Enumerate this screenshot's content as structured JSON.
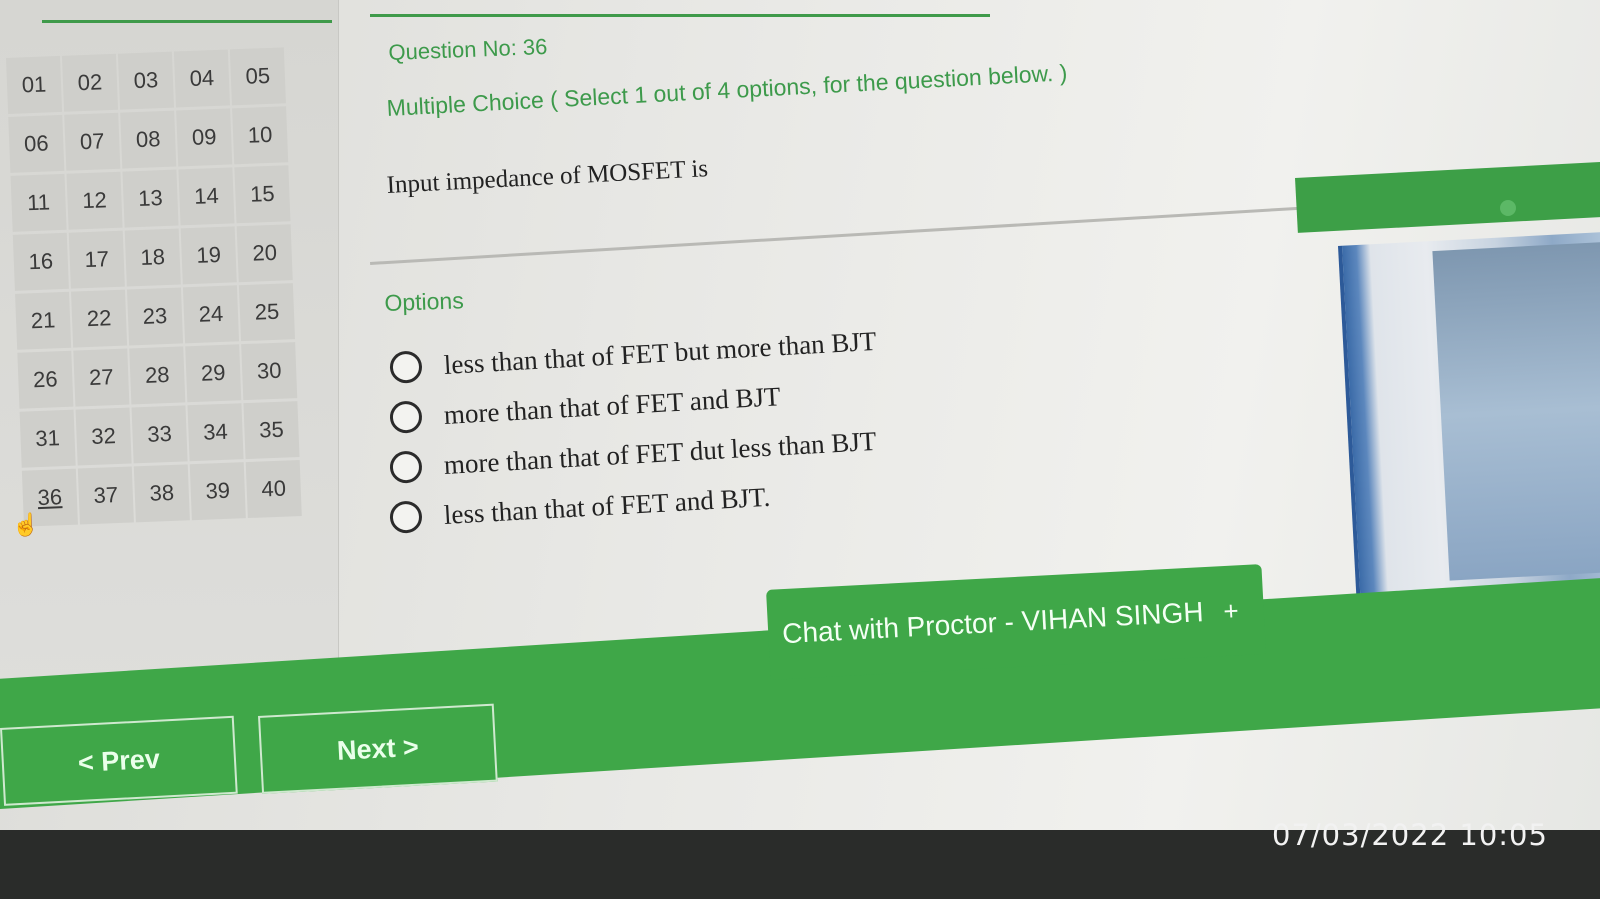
{
  "question_palette": {
    "items": [
      "01",
      "02",
      "03",
      "04",
      "05",
      "06",
      "07",
      "08",
      "09",
      "10",
      "11",
      "12",
      "13",
      "14",
      "15",
      "16",
      "17",
      "18",
      "19",
      "20",
      "21",
      "22",
      "23",
      "24",
      "25",
      "26",
      "27",
      "28",
      "29",
      "30",
      "31",
      "32",
      "33",
      "34",
      "35",
      "36",
      "37",
      "38",
      "39",
      "40"
    ],
    "current": "36"
  },
  "question": {
    "number_label": "Question No: 36",
    "type_label": "Multiple Choice ( Select 1 out of 4 options, for the question below. )",
    "text": "Input impedance of MOSFET is"
  },
  "options": {
    "heading": "Options",
    "items": [
      "less than that of FET but more than BJT",
      "more than that of FET and BJT",
      "more than that of FET dut less than BJT",
      "less than that of FET and BJT."
    ]
  },
  "chat": {
    "label": "Chat with Proctor - VIHAN SINGH",
    "expand_symbol": "+"
  },
  "navigation": {
    "prev_label": "< Prev",
    "next_label": "Next >"
  },
  "overlay": {
    "timestamp": "07/03/2022 10:05"
  },
  "icons": {
    "cursor": "hand-pointer-icon",
    "status_dot": "status-dot-icon"
  },
  "colors": {
    "accent_green": "#3fa748",
    "label_green": "#3d9a4b"
  }
}
